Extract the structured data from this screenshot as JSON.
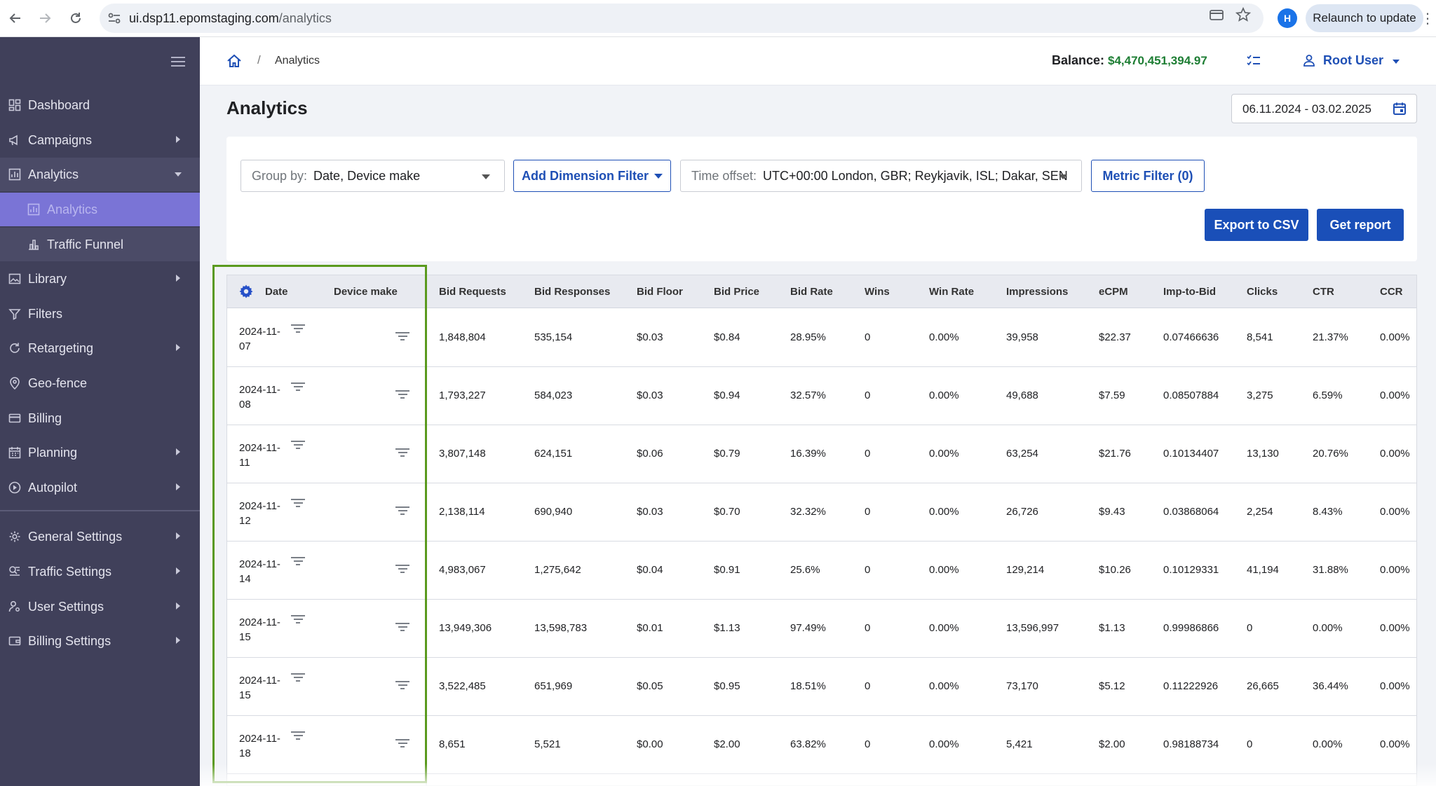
{
  "browser": {
    "url_host": "ui.dsp11.epomstaging.com",
    "url_path": "/analytics",
    "profile_initial": "H",
    "relaunch_label": "Relaunch to update"
  },
  "sidebar": {
    "items": [
      {
        "label": "Dashboard",
        "icon": "dashboard-icon"
      },
      {
        "label": "Campaigns",
        "icon": "megaphone-icon"
      },
      {
        "label": "Analytics",
        "icon": "chart-icon"
      },
      {
        "label": "Analytics",
        "icon": "chart-icon"
      },
      {
        "label": "Traffic Funnel",
        "icon": "bar-chart-icon"
      },
      {
        "label": "Library",
        "icon": "image-icon"
      },
      {
        "label": "Filters",
        "icon": "filter-icon"
      },
      {
        "label": "Retargeting",
        "icon": "refresh-icon"
      },
      {
        "label": "Geo-fence",
        "icon": "map-pin-icon"
      },
      {
        "label": "Billing",
        "icon": "card-icon"
      },
      {
        "label": "Planning",
        "icon": "calendar-icon"
      },
      {
        "label": "Autopilot",
        "icon": "play-circle-icon"
      },
      {
        "label": "General Settings",
        "icon": "gear-icon"
      },
      {
        "label": "Traffic Settings",
        "icon": "search-list-icon"
      },
      {
        "label": "User Settings",
        "icon": "user-gear-icon"
      },
      {
        "label": "Billing Settings",
        "icon": "wallet-icon"
      }
    ]
  },
  "header": {
    "breadcrumb_current": "Analytics",
    "balance_label": "Balance:",
    "balance_value": "$4,470,451,394.97",
    "user_name": "Root User"
  },
  "page": {
    "title": "Analytics",
    "date_range": "06.11.2024 - 03.02.2025"
  },
  "filters": {
    "group_by_label": "Group by:",
    "group_by_value": "Date, Device make",
    "add_dimension_label": "Add Dimension Filter",
    "time_offset_label": "Time offset:",
    "time_offset_value": "UTC+00:00 London, GBR; Reykjavik, ISL; Dakar, SEN",
    "metric_filter_label": "Metric Filter (0)",
    "export_label": "Export to CSV",
    "get_report_label": "Get report"
  },
  "table": {
    "columns": [
      "Date",
      "Device make",
      "Bid Requests",
      "Bid Responses",
      "Bid Floor",
      "Bid Price",
      "Bid Rate",
      "Wins",
      "Win Rate",
      "Impressions",
      "eCPM",
      "Imp-to-Bid",
      "Clicks",
      "CTR",
      "CCR"
    ],
    "rows": [
      [
        "2024-11-07",
        "",
        "1,848,804",
        "535,154",
        "$0.03",
        "$0.84",
        "28.95%",
        "0",
        "0.00%",
        "39,958",
        "$22.37",
        "0.07466636",
        "8,541",
        "21.37%",
        "0.00%"
      ],
      [
        "2024-11-08",
        "",
        "1,793,227",
        "584,023",
        "$0.03",
        "$0.94",
        "32.57%",
        "0",
        "0.00%",
        "49,688",
        "$7.59",
        "0.08507884",
        "3,275",
        "6.59%",
        "0.00%"
      ],
      [
        "2024-11-11",
        "",
        "3,807,148",
        "624,151",
        "$0.06",
        "$0.79",
        "16.39%",
        "0",
        "0.00%",
        "63,254",
        "$21.76",
        "0.10134407",
        "13,130",
        "20.76%",
        "0.00%"
      ],
      [
        "2024-11-12",
        "",
        "2,138,114",
        "690,940",
        "$0.03",
        "$0.70",
        "32.32%",
        "0",
        "0.00%",
        "26,726",
        "$9.43",
        "0.03868064",
        "2,254",
        "8.43%",
        "0.00%"
      ],
      [
        "2024-11-14",
        "",
        "4,983,067",
        "1,275,642",
        "$0.04",
        "$0.91",
        "25.6%",
        "0",
        "0.00%",
        "129,214",
        "$10.26",
        "0.10129331",
        "41,194",
        "31.88%",
        "0.00%"
      ],
      [
        "2024-11-15",
        "",
        "13,949,306",
        "13,598,783",
        "$0.01",
        "$1.13",
        "97.49%",
        "0",
        "0.00%",
        "13,596,997",
        "$1.13",
        "0.99986866",
        "0",
        "0.00%",
        "0.00%"
      ],
      [
        "2024-11-15",
        "",
        "3,522,485",
        "651,969",
        "$0.05",
        "$0.95",
        "18.51%",
        "0",
        "0.00%",
        "73,170",
        "$5.12",
        "0.11222926",
        "26,665",
        "36.44%",
        "0.00%"
      ],
      [
        "2024-11-18",
        "",
        "8,651",
        "5,521",
        "$0.00",
        "$2.00",
        "63.82%",
        "0",
        "0.00%",
        "5,421",
        "$2.00",
        "0.98188734",
        "0",
        "0.00%",
        "0.00%"
      ]
    ]
  },
  "colors": {
    "sidebar_bg": "#40405a",
    "sidebar_active": "#7a74d6",
    "primary": "#1a4fb8",
    "balance_green": "#1e7e34",
    "highlight": "#5a9a1e"
  }
}
